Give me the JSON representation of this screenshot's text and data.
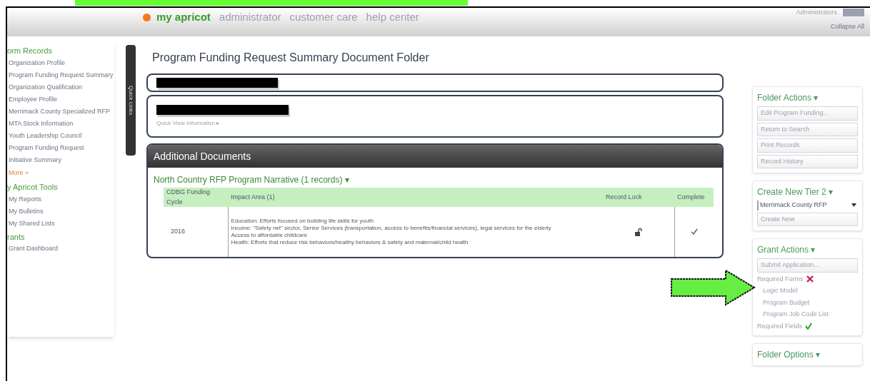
{
  "topnav": {
    "brand": "my apricot",
    "links": [
      "administrator",
      "customer care",
      "help center"
    ],
    "user": "Administrators",
    "collapse": "Collapse All"
  },
  "sidebar": {
    "items": [
      {
        "kind": "heading",
        "label": "orm Records"
      },
      {
        "kind": "link",
        "label": "Organization Profile"
      },
      {
        "kind": "link",
        "label": "Program Funding Request Summary"
      },
      {
        "kind": "link",
        "label": "Organization Qualification"
      },
      {
        "kind": "link",
        "label": "Employee Profile"
      },
      {
        "kind": "link",
        "label": "Merrimack County Specialized RFP"
      },
      {
        "kind": "link",
        "label": "MTA Stock Information"
      },
      {
        "kind": "link",
        "label": "Youth Leadership Council"
      },
      {
        "kind": "link",
        "label": "Program Funding Request"
      },
      {
        "kind": "link",
        "label": "Initiative Summary"
      },
      {
        "kind": "more",
        "label": "More »"
      },
      {
        "kind": "heading",
        "label": "y Apricot Tools"
      },
      {
        "kind": "link",
        "label": "My Reports"
      },
      {
        "kind": "link",
        "label": "My Bulletins"
      },
      {
        "kind": "link",
        "label": "My Shared Lists"
      },
      {
        "kind": "heading",
        "label": "rants"
      },
      {
        "kind": "link",
        "label": "Grant Dashboard"
      }
    ],
    "tab": "Quick Links"
  },
  "main": {
    "title": "Program Funding Request Summary Document Folder",
    "quick_view": "Quick View Information ▸",
    "panel": {
      "title": "Additional Documents",
      "link": "North Country RFP Program Narrative (1 records) ▾",
      "table": {
        "columns": [
          "CDBG Funding Cycle",
          "Impact Area (1)",
          "Record Lock",
          "Complete"
        ],
        "rows": [
          {
            "cycle": "2016",
            "impact": [
              "Education: Efforts focused on building life skills for youth",
              "Income: \"Safety net\" sector, Senior Services (transportation, access to benefits/financial services), legal services for the elderly",
              "Access to affordable childcare",
              "Health: Efforts that reduce risk behaviors/healthy behaviors & safety and maternal/child health"
            ],
            "locked": false,
            "complete": true
          }
        ]
      }
    }
  },
  "right": {
    "sections": [
      {
        "title": "Folder Actions ▾",
        "buttons": [
          "Edit Program Funding...",
          "Return to Search",
          "Print Records",
          "Record History"
        ]
      },
      {
        "title": "Create New Tier 2 ▾",
        "select": "Merrimack County RFP",
        "buttons": [
          "Create New"
        ]
      },
      {
        "title": "Grant Actions ▾",
        "buttons": [
          "Submit Application..."
        ],
        "checks": [
          {
            "label": "Required Forms",
            "ok": false,
            "items": [
              "Logic Model",
              "Program Budget",
              "Program Job Code List"
            ]
          },
          {
            "label": "Required Fields",
            "ok": true
          }
        ]
      },
      {
        "title": "Folder Options ▾"
      }
    ]
  }
}
